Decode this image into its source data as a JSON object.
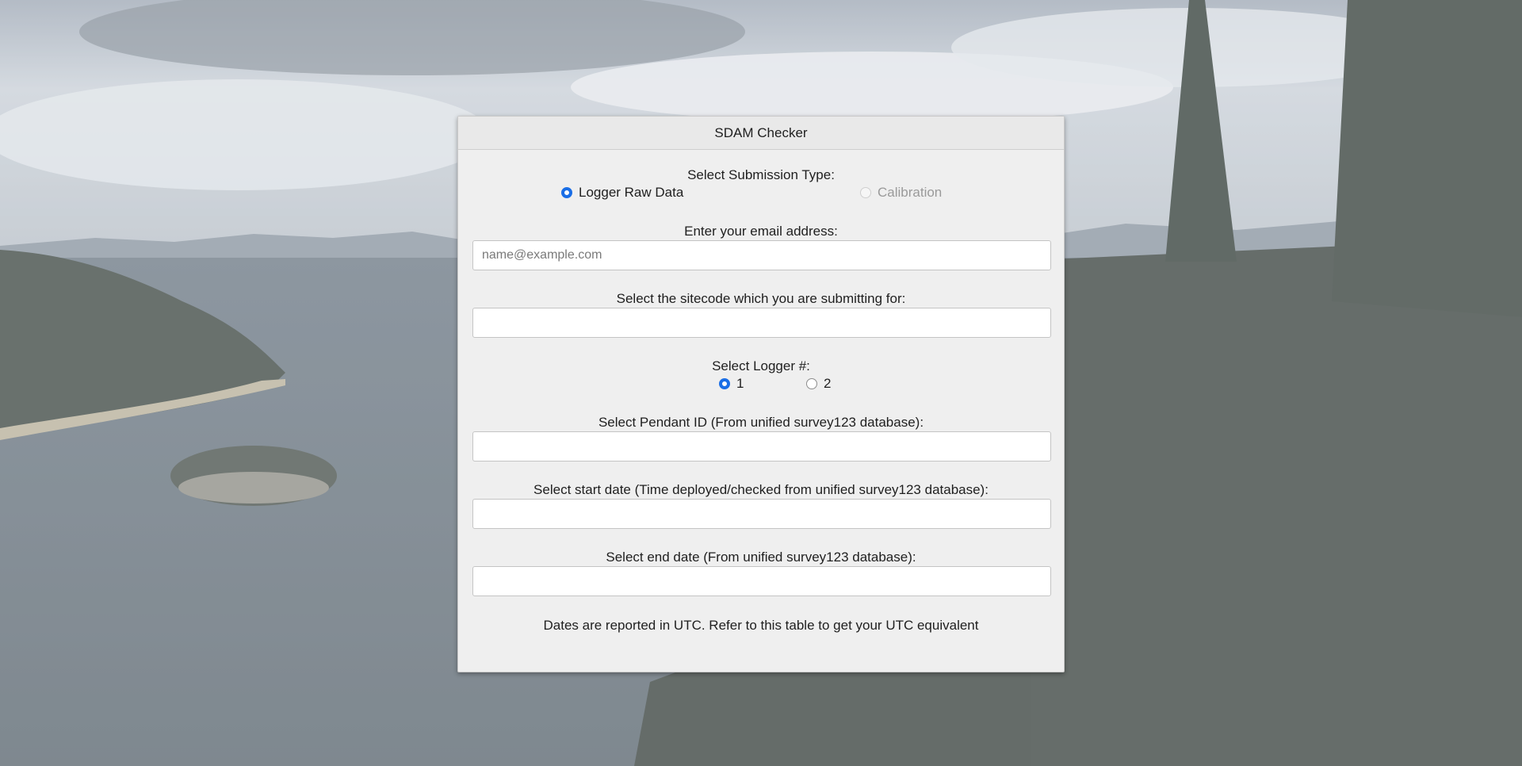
{
  "modal": {
    "title": "SDAM Checker"
  },
  "submission_type": {
    "label": "Select Submission Type:",
    "options": [
      {
        "label": "Logger Raw Data",
        "checked": true,
        "disabled": false
      },
      {
        "label": "Calibration",
        "checked": false,
        "disabled": true
      }
    ]
  },
  "email": {
    "label": "Enter your email address:",
    "value": "",
    "placeholder": "name@example.com"
  },
  "sitecode": {
    "label": "Select the sitecode which you are submitting for:",
    "value": ""
  },
  "logger": {
    "label": "Select Logger #:",
    "options": [
      {
        "label": "1",
        "checked": true
      },
      {
        "label": "2",
        "checked": false
      }
    ]
  },
  "pendant": {
    "label": "Select Pendant ID (From unified survey123 database):",
    "value": ""
  },
  "start_date": {
    "label": "Select start date (Time deployed/checked from unified survey123 database):",
    "value": ""
  },
  "end_date": {
    "label": "Select end date (From unified survey123 database):",
    "value": ""
  },
  "note": {
    "text": "Dates are reported in UTC. Refer to this table to get your UTC equivalent"
  },
  "colors": {
    "accent": "#1a6ee6",
    "modal_bg": "#efefef"
  }
}
